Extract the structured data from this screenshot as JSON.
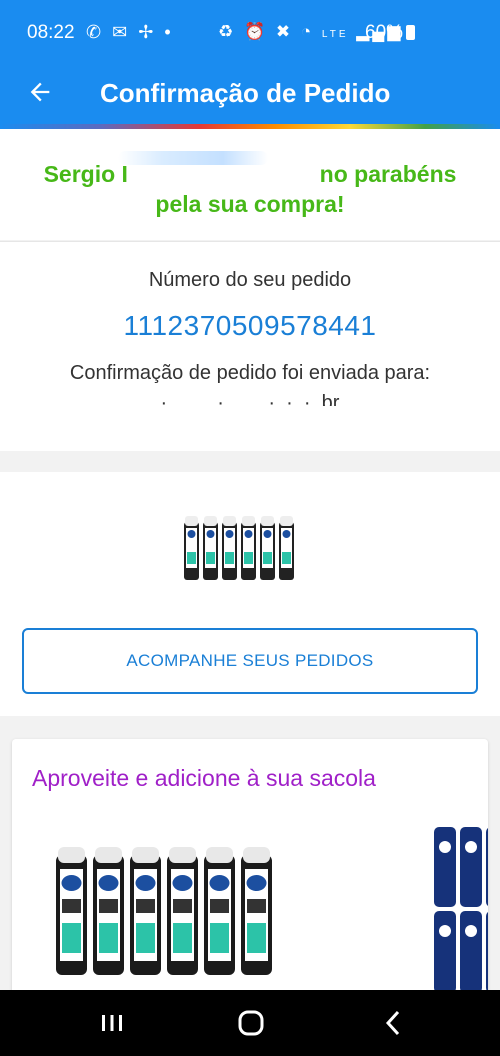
{
  "status_bar": {
    "time": "08:22",
    "battery": "60%",
    "left_icons": [
      "whatsapp-icon",
      "mail-icon",
      "fan-icon",
      "dot-icon"
    ],
    "right_icons": [
      "battery-saver-icon",
      "alarm-icon",
      "mute-icon",
      "wifi-icon",
      "volte-icon",
      "signal-icon"
    ]
  },
  "app_bar": {
    "title": "Confirmação de Pedido"
  },
  "congrats": {
    "line1": "Sergio I                              no parabéns",
    "line2": "pela sua compra!"
  },
  "order": {
    "label": "Número do seu pedido",
    "number": "1112370509578441",
    "sent_label": "Confirmação de pedido foi enviada para:",
    "email_partial": "·         ·        ·  ·  ·  br"
  },
  "product": {
    "track_button": "ACOMPANHE SEUS PEDIDOS"
  },
  "recommendations": {
    "title": "Aproveite e adicione à sua sacola"
  },
  "colors": {
    "primary": "#1a8cf0",
    "link": "#1a7fd6",
    "success": "#47b818",
    "promo": "#a020c8"
  }
}
